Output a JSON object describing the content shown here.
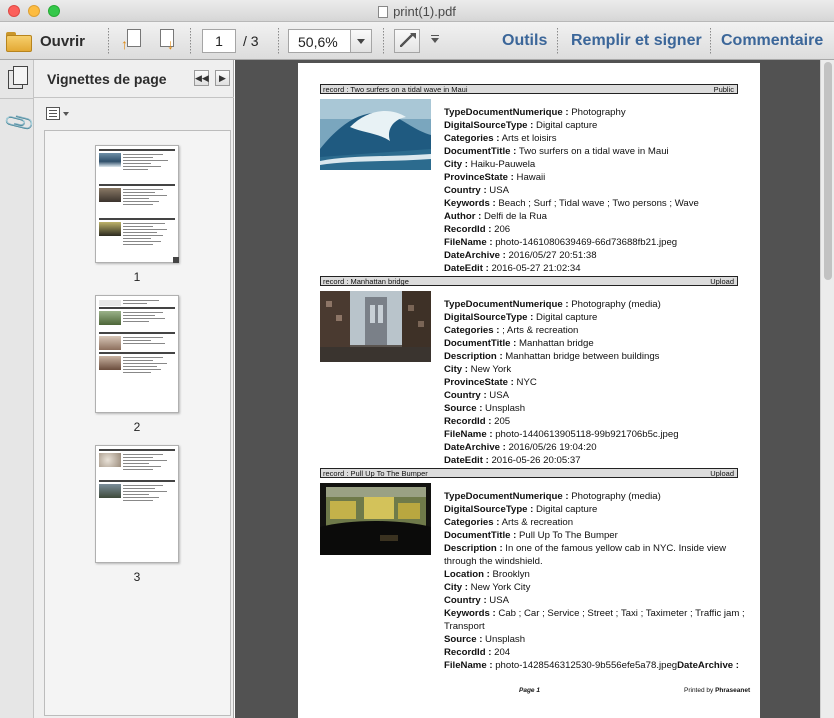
{
  "window": {
    "title": "print(1).pdf"
  },
  "toolbar": {
    "open_label": "Ouvrir",
    "page_current": "1",
    "page_total": "/ 3",
    "zoom": "50,6%",
    "tools": [
      "Outils",
      "Remplir et signer",
      "Commentaire"
    ]
  },
  "sidebar": {
    "title": "Vignettes de page",
    "prev_label": "◀◀",
    "next_label": "▶",
    "thumbnails": [
      "1",
      "2",
      "3"
    ]
  },
  "colors": {
    "accent": "#3b6699",
    "viewer_bg": "#525252",
    "record_bar": "#dcdcdc"
  },
  "document": {
    "records": [
      {
        "header": "record : Two surfers on a tidal wave in Maui",
        "tag": "Public",
        "image": "wave-photo",
        "fields": [
          {
            "k": "TypeDocumentNumerique :",
            "v": " Photography"
          },
          {
            "k": "DigitalSourceType :",
            "v": " Digital capture"
          },
          {
            "k": "Categories :",
            "v": " Arts et loisirs"
          },
          {
            "k": "DocumentTitle :",
            "v": " Two surfers on a tidal wave in Maui"
          },
          {
            "k": "City :",
            "v": " Haiku-Pauwela"
          },
          {
            "k": "ProvinceState :",
            "v": " Hawaii"
          },
          {
            "k": "Country :",
            "v": " USA"
          },
          {
            "k": "Keywords :",
            "v": " Beach ; Surf ; Tidal wave ; Two persons ; Wave"
          },
          {
            "k": "Author :",
            "v": " Delfi de la Rua"
          },
          {
            "k": "RecordId :",
            "v": " 206"
          },
          {
            "k": "FileName :",
            "v": " photo-1461080639469-66d73688fb21.jpeg"
          },
          {
            "k": "DateArchive :",
            "v": " 2016/05/27 20:51:38"
          },
          {
            "k": "DateEdit :",
            "v": " 2016-05-27 21:02:34"
          }
        ]
      },
      {
        "header": "record : Manhattan bridge",
        "tag": "Upload",
        "image": "bridge-photo",
        "fields": [
          {
            "k": "TypeDocumentNumerique :",
            "v": " Photography (media)"
          },
          {
            "k": "DigitalSourceType :",
            "v": " Digital capture"
          },
          {
            "k": "Categories :",
            "v": "  ; Arts & recreation"
          },
          {
            "k": "DocumentTitle :",
            "v": " Manhattan bridge"
          },
          {
            "k": "Description :",
            "v": " Manhattan bridge between buildings"
          },
          {
            "k": "City :",
            "v": " New York"
          },
          {
            "k": "ProvinceState :",
            "v": " NYC"
          },
          {
            "k": "Country :",
            "v": " USA"
          },
          {
            "k": "Source :",
            "v": " Unsplash"
          },
          {
            "k": "RecordId :",
            "v": " 205"
          },
          {
            "k": "FileName :",
            "v": " photo-1440613905118-99b921706b5c.jpeg"
          },
          {
            "k": "DateArchive :",
            "v": " 2016/05/26 19:04:20"
          },
          {
            "k": "DateEdit :",
            "v": " 2016-05-26 20:05:37"
          }
        ]
      },
      {
        "header": "record : Pull Up To The Bumper",
        "tag": "Upload",
        "image": "taxi-photo",
        "fields": [
          {
            "k": "TypeDocumentNumerique :",
            "v": " Photography (media)"
          },
          {
            "k": "DigitalSourceType :",
            "v": " Digital capture"
          },
          {
            "k": "Categories :",
            "v": " Arts & recreation"
          },
          {
            "k": "DocumentTitle :",
            "v": " Pull Up To The Bumper"
          },
          {
            "k": "Description :",
            "v": " In one of the famous yellow cab in NYC. Inside view",
            "cont": "through the windshield."
          },
          {
            "k": "Location :",
            "v": " Brooklyn"
          },
          {
            "k": "City :",
            "v": " New York City"
          },
          {
            "k": "Country :",
            "v": " USA"
          },
          {
            "k": "Keywords :",
            "v": " Cab ; Car ; Service ; Street ; Taxi ; Taximeter ; Traffic jam ;",
            "cont": "Transport"
          },
          {
            "k": "Source :",
            "v": " Unsplash"
          },
          {
            "k": "RecordId :",
            "v": " 204"
          },
          {
            "k": "FileName :",
            "v": " photo-1428546312530-9b556efe5a78.jpeg",
            "k2": "DateArchive :"
          }
        ]
      }
    ],
    "footer_page": "Page 1",
    "footer_printed": "Printed by ",
    "footer_brand": "Phraseanet"
  }
}
